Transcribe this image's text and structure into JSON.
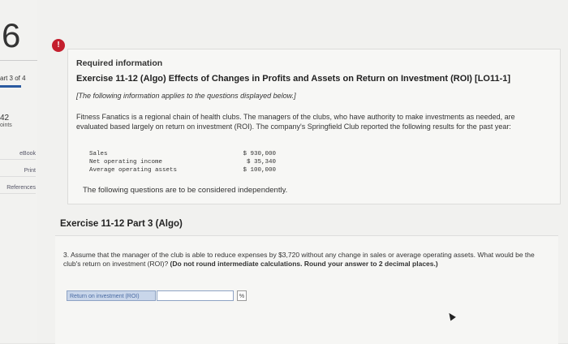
{
  "sidebar": {
    "question_number": "6",
    "part_label": "art 3 of 4",
    "points_value": "42",
    "points_label": "oints",
    "links": [
      "eBook",
      "Print",
      "References"
    ]
  },
  "info": {
    "alert_glyph": "!",
    "required_label": "Required information",
    "exercise_title": "Exercise 11-12 (Algo) Effects of Changes in Profits and Assets on Return on Investment (ROI) [LO11-1]",
    "note": "[The following information applies to the questions displayed below.]",
    "paragraph": "Fitness Fanatics is a regional chain of health clubs. The managers of the clubs, who have authority to make investments as needed, are evaluated based largely on return on investment (ROI). The company's Springfield Club reported the following results for the past year:",
    "table": [
      {
        "label": "Sales",
        "value": "$ 930,000"
      },
      {
        "label": "Net operating income",
        "value": "$ 35,340"
      },
      {
        "label": "Average operating assets",
        "value": "$ 100,000"
      }
    ],
    "independent_note": "The following questions are to be considered independently."
  },
  "part": {
    "title": "Exercise 11-12 Part 3 (Algo)",
    "question_text": "3. Assume that the manager of the club is able to reduce expenses by $3,720 without any change in sales or average operating assets. What would be the club's return on investment (ROI)? ",
    "question_bold": "(Do not round intermediate calculations. Round your answer to 2 decimal places.)",
    "answer_label": "Return on investment (ROI)",
    "answer_value": "",
    "answer_unit": "%"
  }
}
